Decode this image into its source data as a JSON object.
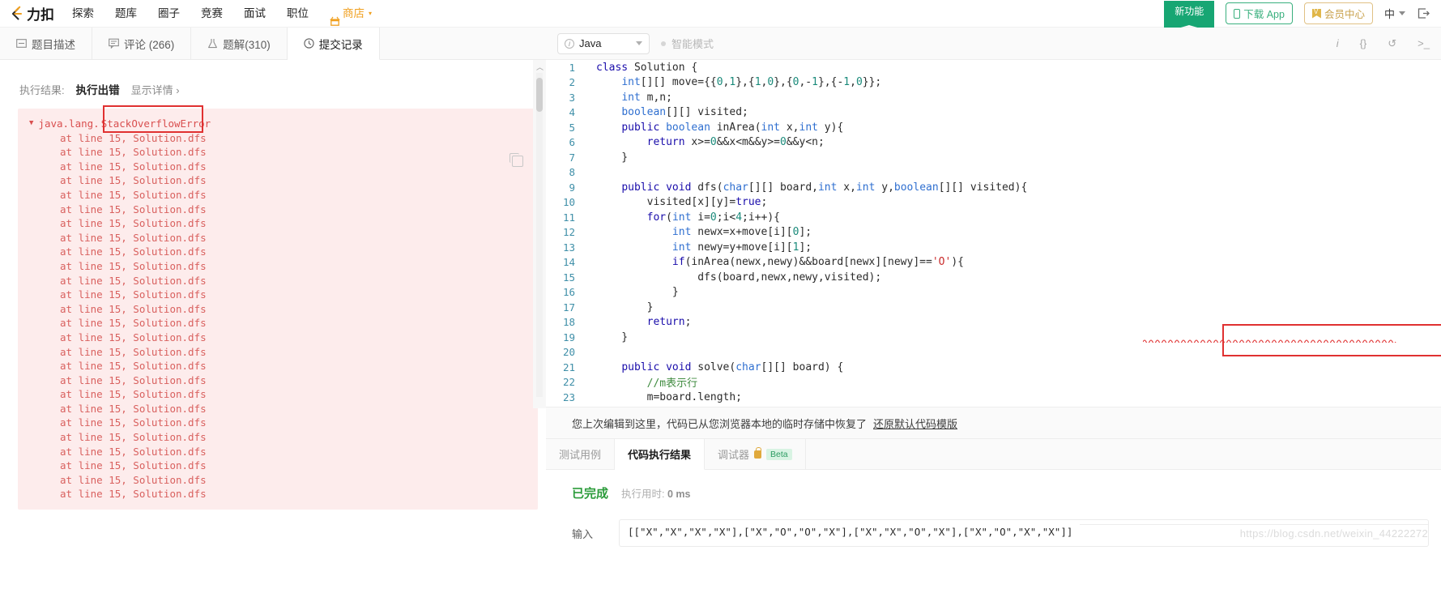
{
  "topnav": {
    "brand": "力扣",
    "logo_icon": "leetcode-logo-icon",
    "items": [
      {
        "label": "探索",
        "name": "nav-explore"
      },
      {
        "label": "题库",
        "name": "nav-problems"
      },
      {
        "label": "圈子",
        "name": "nav-circle"
      },
      {
        "label": "竞赛",
        "name": "nav-contest"
      },
      {
        "label": "面试",
        "name": "nav-interview"
      },
      {
        "label": "职位",
        "name": "nav-jobs"
      }
    ],
    "shop_label": "商店",
    "ribbon_label": "新功能",
    "download_app": "下载 App",
    "vip_center": "会员中心",
    "language": "中",
    "accent_green": "#3ab07e",
    "accent_gold": "#c9a24d",
    "ribbon_color": "#17a673"
  },
  "problem_tabs": [
    {
      "label": "题目描述",
      "icon": "description-icon",
      "active": false
    },
    {
      "label": "评论 (266)",
      "icon": "comment-icon",
      "active": false
    },
    {
      "label": "题解(310)",
      "icon": "solution-flask-icon",
      "active": false
    },
    {
      "label": "提交记录",
      "icon": "clock-icon",
      "active": true
    }
  ],
  "left_panel": {
    "result_label": "执行结果:",
    "result_status": "执行出错",
    "result_detail_link": "显示详情 ›",
    "copy_icon": "copy-icon",
    "error_namespace": "java.lang.",
    "error_name": "StackOverflowError",
    "stack_line": "at line 15, Solution.dfs",
    "stack_repeat_count": 26,
    "error_bg": "#fdecec",
    "error_fg": "#d94f4f",
    "annotation_box_color": "#e03131"
  },
  "editor": {
    "language": "Java",
    "language_icon": "info-circle-icon",
    "smart_mode": "智能模式",
    "tools": [
      {
        "glyph": "i",
        "name": "info-icon"
      },
      {
        "glyph": "{}",
        "name": "format-braces-icon"
      },
      {
        "glyph": "↺",
        "name": "reset-code-icon"
      },
      {
        "glyph": ">_",
        "name": "console-icon"
      }
    ],
    "code_lines": [
      {
        "n": 1,
        "text": "class Solution {"
      },
      {
        "n": 2,
        "text": "    int[][] move={{0,1},{1,0},{0,-1},{-1,0}};"
      },
      {
        "n": 3,
        "text": "    int m,n;"
      },
      {
        "n": 4,
        "text": "    boolean[][] visited;"
      },
      {
        "n": 5,
        "text": "    public boolean inArea(int x,int y){"
      },
      {
        "n": 6,
        "text": "        return x>=0&&x<m&&y>=0&&y<n;"
      },
      {
        "n": 7,
        "text": "    }"
      },
      {
        "n": 8,
        "text": ""
      },
      {
        "n": 9,
        "text": "    public void dfs(char[][] board,int x,int y,boolean[][] visited){"
      },
      {
        "n": 10,
        "text": "        visited[x][y]=true;"
      },
      {
        "n": 11,
        "text": "        for(int i=0;i<4;i++){"
      },
      {
        "n": 12,
        "text": "            int newx=x+move[i][0];"
      },
      {
        "n": 13,
        "text": "            int newy=y+move[i][1];"
      },
      {
        "n": 14,
        "text": "            if(inArea(newx,newy)&&board[newx][newy]=='O'){"
      },
      {
        "n": 15,
        "text": "                dfs(board,newx,newy,visited);"
      },
      {
        "n": 16,
        "text": "            }"
      },
      {
        "n": 17,
        "text": "        }"
      },
      {
        "n": 18,
        "text": "        return;"
      },
      {
        "n": 19,
        "text": "    }"
      },
      {
        "n": 20,
        "text": ""
      },
      {
        "n": 21,
        "text": "    public void solve(char[][] board) {"
      },
      {
        "n": 22,
        "text": "        //m表示行"
      },
      {
        "n": 23,
        "text": "        m=board.length;"
      }
    ],
    "restore_notice": "您上次编辑到这里，代码已从您浏览器本地的临时存储中恢复了",
    "restore_link": "还原默认代码模版"
  },
  "bottom_tabs": [
    {
      "label": "测试用例",
      "active": false,
      "name": "tab-testcase"
    },
    {
      "label": "代码执行结果",
      "active": true,
      "name": "tab-exec-result"
    },
    {
      "label": "调试器",
      "active": false,
      "name": "tab-debugger",
      "lock": true,
      "badge": "Beta"
    }
  ],
  "bottom_result": {
    "status": "已完成",
    "time_label": "执行用时:",
    "time_value": "0 ms",
    "input_label": "输入",
    "input_value": "[[\"X\",\"X\",\"X\",\"X\"],[\"X\",\"O\",\"O\",\"X\"],[\"X\",\"X\",\"O\",\"X\"],[\"X\",\"O\",\"X\",\"X\"]]",
    "status_color": "#2d9c3c"
  },
  "watermark": "https://blog.csdn.net/weixin_44222272"
}
